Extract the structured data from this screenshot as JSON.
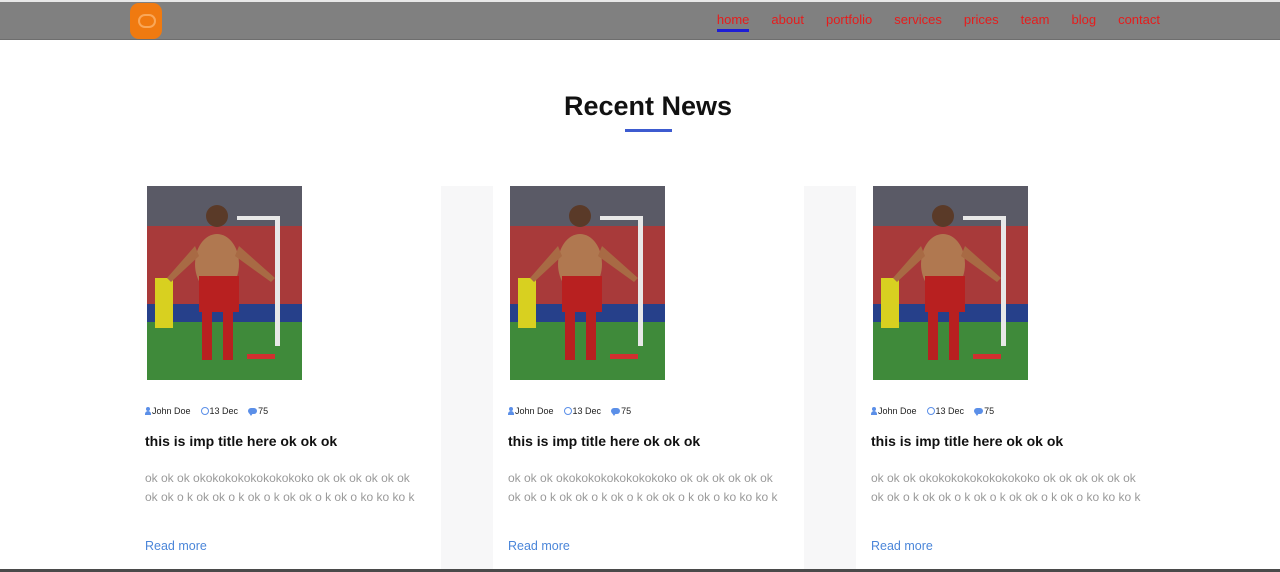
{
  "header": {
    "nav": [
      {
        "label": "home",
        "active": true
      },
      {
        "label": "about",
        "active": false
      },
      {
        "label": "portfolio",
        "active": false
      },
      {
        "label": "services",
        "active": false
      },
      {
        "label": "prices",
        "active": false
      },
      {
        "label": "team",
        "active": false
      },
      {
        "label": "blog",
        "active": false
      },
      {
        "label": "contact",
        "active": false
      }
    ]
  },
  "section": {
    "title": "Recent News"
  },
  "posts": [
    {
      "author": "John Doe",
      "date": "13 Dec",
      "comments": "75",
      "title": "this is imp title here ok ok ok",
      "excerpt": "ok ok ok okokokokokokokokoko ok ok ok ok ok ok ok ok o k ok ok o k ok o k ok ok o k ok o ko ko ko k",
      "link": "Read more"
    },
    {
      "author": "John Doe",
      "date": "13 Dec",
      "comments": "75",
      "title": "this is imp title here ok ok ok",
      "excerpt": "ok ok ok okokokokokokokokoko ok ok ok ok ok ok ok ok o k ok ok o k ok o k ok ok o k ok o ko ko ko k",
      "link": "Read more"
    },
    {
      "author": "John Doe",
      "date": "13 Dec",
      "comments": "75",
      "title": "this is imp title here ok ok ok",
      "excerpt": "ok ok ok okokokokokokokokoko ok ok ok ok ok ok ok ok o k ok ok o k ok o k ok ok o k ok o ko ko ko k",
      "link": "Read more"
    }
  ],
  "colors": {
    "header_bg": "#808080",
    "nav_text": "#e61c1c",
    "nav_active_underline": "#1d1dd6",
    "logo": "#f07a10",
    "title_underline": "#3d5bd0",
    "link": "#4b86d9"
  }
}
